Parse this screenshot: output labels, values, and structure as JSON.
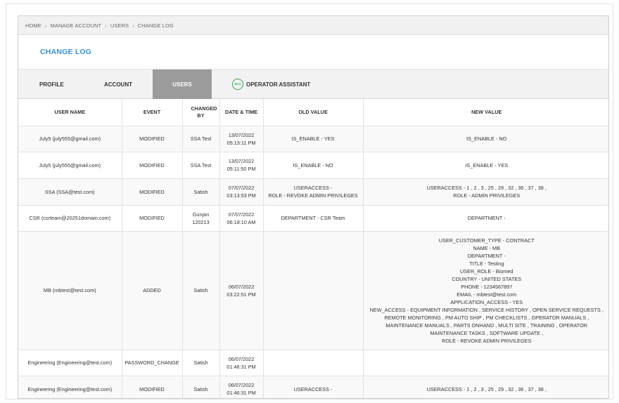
{
  "breadcrumb": [
    "HOME",
    "MANAGE ACCOUNT",
    "USERS",
    "CHANGE LOG"
  ],
  "page_title": "CHANGE LOG",
  "tabs": [
    {
      "label": "PROFILE"
    },
    {
      "label": "ACCOUNT"
    },
    {
      "label": "USERS"
    },
    {
      "label": "OPERATOR ASSISTANT",
      "badge": "BETA"
    }
  ],
  "table": {
    "headers": [
      "USER NAME",
      "EVENT",
      "CHANGED BY",
      "DATE & TIME",
      "OLD VALUE",
      "NEW VALUE"
    ],
    "rows": [
      {
        "user": "July5 (july555@gmail.com)",
        "event": "MODIFIED",
        "changed_by": [
          "SSA Test"
        ],
        "datetime": [
          "13/07/2022",
          "05:13:11 PM"
        ],
        "old": [
          "IS_ENABLE - YES"
        ],
        "new": [
          "IS_ENABLE - NO"
        ]
      },
      {
        "user": "July5 (july555@gmail.com)",
        "event": "MODIFIED",
        "changed_by": [
          "SSA Test"
        ],
        "datetime": [
          "13/07/2022",
          "05:11:50 PM"
        ],
        "old": [
          "IS_ENABLE - NO"
        ],
        "new": [
          "IS_ENABLE - YES"
        ]
      },
      {
        "user": "SSA (SSA@test.com)",
        "event": "MODIFIED",
        "changed_by": [
          "Satish"
        ],
        "datetime": [
          "07/07/2022",
          "03:13:53 PM"
        ],
        "old": [
          "USERACCESS -",
          "ROLE - REVOKE ADMIN PRIVILEGES"
        ],
        "new": [
          "USERACCESS - 1 , 2 , 3 , 25 , 29 , 32 , 36 , 37 , 38 ,",
          "ROLE - ADMIN PRIVILEGES"
        ]
      },
      {
        "user": "CSR (csrteam@20251domain.com)",
        "event": "MODIFIED",
        "changed_by": [
          "Gunjan",
          "120213"
        ],
        "datetime": [
          "07/07/2022",
          "06:18:10 AM"
        ],
        "old": [
          "DEPARTMENT - CSR Team"
        ],
        "new": [
          "DEPARTMENT -"
        ]
      },
      {
        "user": "MB (mbtest@test.com)",
        "event": "ADDED",
        "changed_by": [
          "Satish"
        ],
        "datetime": [
          "06/07/2022",
          "03:22:51 PM"
        ],
        "old": [],
        "new": [
          "USER_CUSTOMER_TYPE - CONTRACT",
          "NAME - MB",
          "DEPARTMENT -",
          "TITLE - Testing",
          "USER_ROLE - Biomed",
          "COUNTRY - UNITED STATES",
          "PHONE - 1234567897",
          "EMAIL - mbtest@test.com",
          "APPLICATION_ACCESS - YES",
          "NEW_ACCESS - EQUIPMENT INFORMATION , SERVICE HISTORY , OPEN SERVICE REQUESTS ,",
          "REMOTE MONITORING , PM AUTO SHIP , PM CHECKLISTS , OPERATOR MANUALS ,",
          "MAINTENANCE MANUALS , PARTS ONHAND , MULTI SITE , TRAINING , OPERATOR",
          "MAINTENANCE TASKS , SOFTWARE UPDATE ,",
          "ROLE - REVOKE ADMIN PRIVILEGES"
        ]
      },
      {
        "user": "Engineering (Engineering@test.com)",
        "event": "PASSWORD_CHANGE",
        "changed_by": [
          "Satish"
        ],
        "datetime": [
          "06/07/2022",
          "01:46:31 PM"
        ],
        "old": [],
        "new": []
      },
      {
        "user": "Engineering (Engineering@test.com)",
        "event": "MODIFIED",
        "changed_by": [
          "Satish"
        ],
        "datetime": [
          "06/07/2022",
          "01:46:31 PM"
        ],
        "old": [
          "USERACCESS -"
        ],
        "new": [
          "USERACCESS - 1 , 2 , 3 , 25 , 29 , 32 , 36 , 37 , 38 ,"
        ]
      }
    ]
  }
}
